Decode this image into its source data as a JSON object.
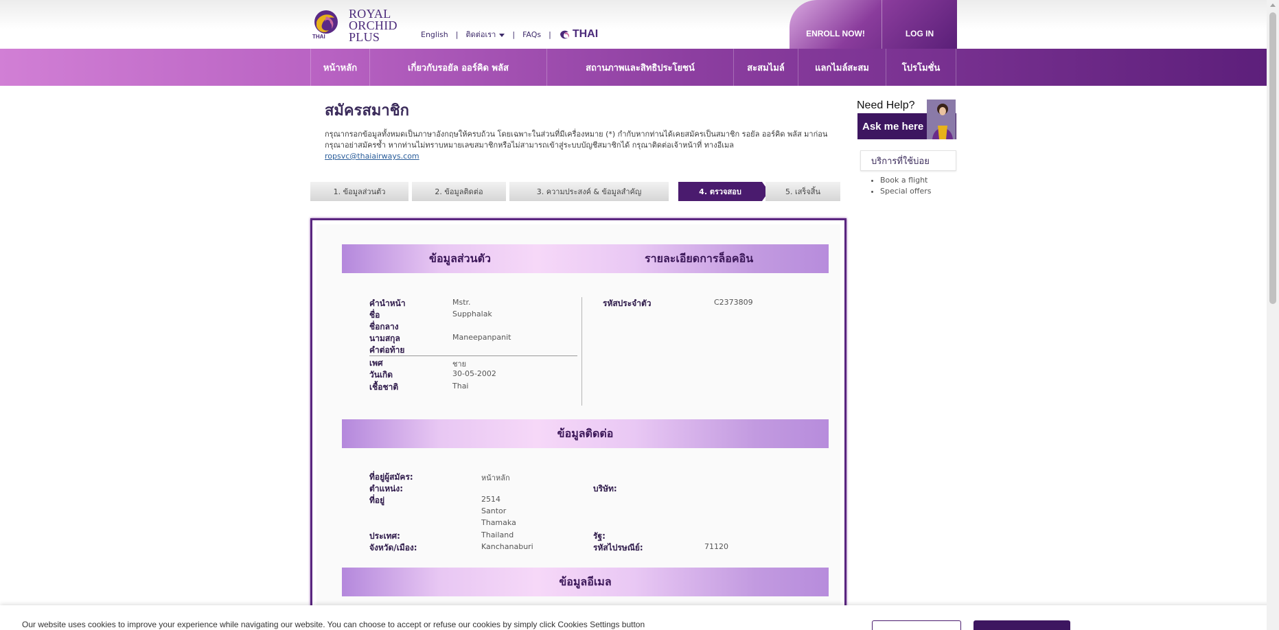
{
  "header": {
    "logo": {
      "brand_line1": "ROYAL",
      "brand_line2": "ORCHID",
      "brand_line3": "PLUS",
      "mark_label": "THAI"
    },
    "links": {
      "english": "English",
      "contact": "ติดต่อเรา",
      "faqs": "FAQs",
      "thai_brand": "THAI"
    },
    "enroll_label": "ENROLL NOW!",
    "login_label": "LOG IN"
  },
  "nav": {
    "items": [
      {
        "label": "หน้าหลัก"
      },
      {
        "label": "เกี่ยวกับรอยัล ออร์คิด พลัส"
      },
      {
        "label": "สถานภาพและสิทธิประโยชน์"
      },
      {
        "label": "สะสมไมล์"
      },
      {
        "label": "แลกไมล์สะสม"
      },
      {
        "label": "โปรโมชั่น"
      }
    ]
  },
  "page": {
    "title": "สมัครสมาชิก",
    "intro_text": "กรุณากรอกข้อมูลทั้งหมดเป็นภาษาอังกฤษให้ครบถ้วน โดยเฉพาะในส่วนที่มีเครื่องหมาย (*) กำกับหากท่านได้เคยสมัครเป็นสมาชิก รอยัล ออร์คิด พลัส มาก่อน กรุณาอย่าสมัครซ้ำ หากท่านไม่ทราบหมายเลขสมาชิกหรือไม่สามารถเข้าสู่ระบบบัญชีสมาชิกได้ กรุณาติดต่อเจ้าหน้าที่ ทางอีเมล",
    "email_link": "ropsvc@thaiairways.com"
  },
  "steps": [
    {
      "label": "1. ข้อมูลส่วนตัว",
      "active": false
    },
    {
      "label": "2. ข้อมูลติดต่อ",
      "active": false
    },
    {
      "label": "3. ความประสงค์ & ข้อมูลสำคัญ",
      "active": false
    },
    {
      "label": "4. ตรวจสอบ",
      "active": true
    },
    {
      "label": "5. เสร็จสิ้น",
      "active": false
    }
  ],
  "sidebar": {
    "help_title": "Need Help?",
    "help_button": "Ask me here",
    "services_title": "บริการที่ใช้บ่อย",
    "services": [
      "Book a flight",
      "Special offers"
    ]
  },
  "personal": {
    "heading_left": "ข้อมูลส่วนตัว",
    "heading_right": "รายละเอียดการล็อคอิน",
    "fields": [
      {
        "label": "คำนำหน้า",
        "value": "Mstr."
      },
      {
        "label": "ชื่อ",
        "value": "Supphalak"
      },
      {
        "label": "ชื่อกลาง",
        "value": ""
      },
      {
        "label": "นามสกุล",
        "value": "Maneepanpanit"
      },
      {
        "label": "คำต่อท้าย",
        "value": ""
      },
      {
        "label": "เพศ",
        "value": "ชาย"
      },
      {
        "label": "วันเกิด",
        "value": "30-05-2002"
      },
      {
        "label": "เชื้อชาติ",
        "value": "Thai"
      }
    ],
    "login_fields": [
      {
        "label": "รหัสประจำตัว",
        "value": "C2373809"
      }
    ]
  },
  "contact": {
    "heading": "ข้อมูลติดต่อ",
    "address_type_label": "ที่อยู่ผู้สมัคร:",
    "address_type_value": "หน้าหลัก",
    "position_label": "ตำแหน่ง:",
    "position_value": "",
    "company_label": "บริษัท:",
    "company_value": "",
    "address_label": "ที่อยู่",
    "address_lines": [
      "2514",
      "Santor",
      "Thamaka"
    ],
    "country_label": "ประเทศ:",
    "country_value": "Thailand",
    "state_label": "รัฐ:",
    "state_value": "",
    "province_label": "จังหวัด/เมือง:",
    "province_value": "Kanchanaburi",
    "postal_label": "รหัสไปรษณีย์:",
    "postal_value": "71120"
  },
  "email_section": {
    "heading": "ข้อมูลอีเมล"
  },
  "cookie": {
    "text": "Our website uses cookies to improve your experience while navigating our website. You can choose to accept or refuse our cookies by simply click Cookies Settings button"
  },
  "colors": {
    "brand_purple": "#4a1b6e",
    "accent": "#b963c3"
  }
}
